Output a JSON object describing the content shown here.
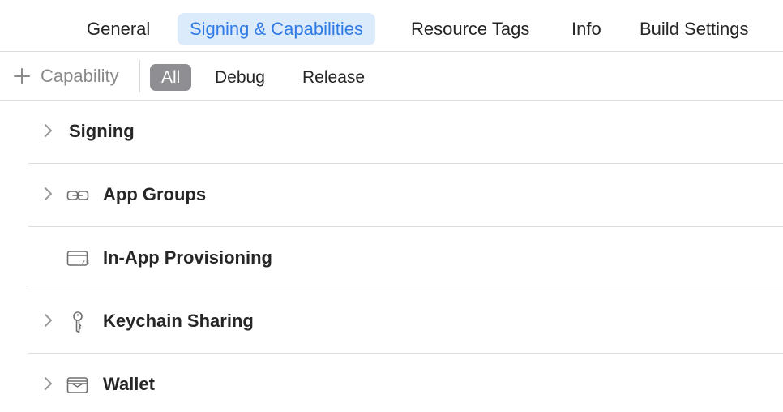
{
  "tabs": [
    {
      "label": "General",
      "active": false
    },
    {
      "label": "Signing & Capabilities",
      "active": true
    },
    {
      "label": "Resource Tags",
      "active": false
    },
    {
      "label": "Info",
      "active": false
    },
    {
      "label": "Build Settings",
      "active": false
    }
  ],
  "toolbar": {
    "add_capability_label": "Capability",
    "filters": [
      {
        "label": "All",
        "active": true
      },
      {
        "label": "Debug",
        "active": false
      },
      {
        "label": "Release",
        "active": false
      }
    ]
  },
  "capabilities": [
    {
      "label": "Signing",
      "expandable": true,
      "icon": "none"
    },
    {
      "label": "App Groups",
      "expandable": true,
      "icon": "link-icon"
    },
    {
      "label": "In-App Provisioning",
      "expandable": false,
      "icon": "card-123-icon"
    },
    {
      "label": "Keychain Sharing",
      "expandable": true,
      "icon": "key-icon"
    },
    {
      "label": "Wallet",
      "expandable": true,
      "icon": "wallet-icon"
    }
  ],
  "colors": {
    "accent": "#2f7ae5",
    "active_tab_bg": "#dcebfb",
    "segment_active_bg": "#8e8e93",
    "separator": "#dcdcdc"
  }
}
